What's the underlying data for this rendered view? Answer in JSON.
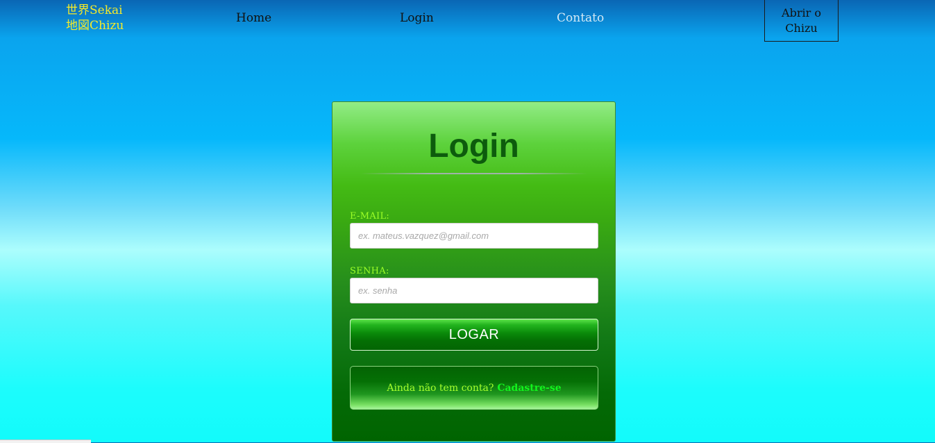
{
  "header": {
    "logo_line1": "世界Sekai",
    "logo_line2": "地図Chizu",
    "nav": {
      "home": "Home",
      "login": "Login",
      "contact": "Contato"
    },
    "open_button": "Abrir o Chizu"
  },
  "login_card": {
    "title": "Login",
    "email_label": "E-MAIL:",
    "email_placeholder": "ex. mateus.vazquez@gmail.com",
    "password_label": "SENHA:",
    "password_placeholder": "ex. senha",
    "submit_label": "LOGAR",
    "signup_prompt": "Ainda não tem conta?",
    "signup_link": "Cadastre-se"
  },
  "colors": {
    "logo": "#f5ea2a",
    "card_title": "#0d5c0d",
    "field_label": "#9cff27",
    "signup_link": "#12f41e"
  }
}
